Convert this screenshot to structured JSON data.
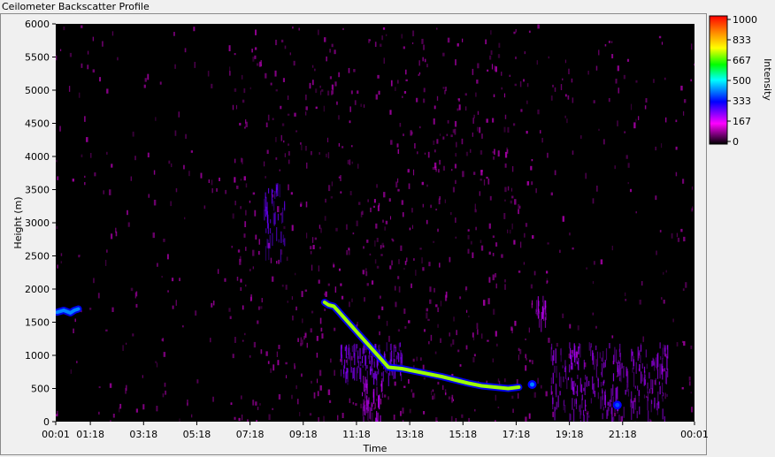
{
  "window": {
    "title": "Ceilometer Backscatter Profile"
  },
  "chart_data": {
    "type": "heatmap",
    "title": "Ceilometer Backscatter Profile",
    "xlabel": "Time",
    "ylabel": "Height (m)",
    "x_ticks": [
      "00:01",
      "01:18",
      "03:18",
      "05:18",
      "07:18",
      "09:18",
      "11:18",
      "13:18",
      "15:18",
      "17:18",
      "19:18",
      "21:18",
      "00:01"
    ],
    "y_ticks": [
      0,
      500,
      1000,
      1500,
      2000,
      2500,
      3000,
      3500,
      4000,
      4500,
      5000,
      5500,
      6000
    ],
    "ylim": [
      0,
      6000
    ],
    "xlim_hours": [
      0,
      24
    ],
    "colorbar": {
      "label": "Intensity",
      "ticks": [
        "1000",
        "833",
        "667",
        "500",
        "333",
        "167",
        "0"
      ],
      "range": [
        0,
        1000
      ],
      "colors": [
        "#000000",
        "#ff00ff",
        "#0000ff",
        "#00ffff",
        "#00ff00",
        "#ffff00",
        "#ff8000",
        "#ff0000"
      ]
    },
    "background_scatter": {
      "description_level": "magenta speckle",
      "intensity": 120
    },
    "cloud_base_layers": [
      {
        "name": "early-low",
        "points": [
          [
            0.05,
            1650
          ],
          [
            0.3,
            1680
          ],
          [
            0.55,
            1640
          ],
          [
            0.7,
            1680
          ],
          [
            0.85,
            1700
          ]
        ],
        "intensity": 420
      },
      {
        "name": "midday-descending",
        "points": [
          [
            10.1,
            1800
          ],
          [
            10.25,
            1760
          ],
          [
            10.45,
            1740
          ],
          [
            12.5,
            820
          ],
          [
            13.0,
            800
          ],
          [
            13.5,
            760
          ],
          [
            14.0,
            720
          ],
          [
            14.5,
            680
          ],
          [
            15.0,
            630
          ],
          [
            15.5,
            580
          ],
          [
            16.0,
            540
          ],
          [
            16.5,
            520
          ],
          [
            17.0,
            500
          ],
          [
            17.4,
            520
          ]
        ],
        "intensity": 700
      },
      {
        "name": "evening-spot",
        "points": [
          [
            17.9,
            560
          ]
        ],
        "intensity": 420
      },
      {
        "name": "night-spot",
        "points": [
          [
            21.1,
            250
          ]
        ],
        "intensity": 380
      }
    ],
    "aerosol_plumes": [
      {
        "t_start": 7.8,
        "t_end": 8.6,
        "h_low": 2600,
        "h_high": 3600,
        "intensity": 260
      },
      {
        "t_start": 10.7,
        "t_end": 13.0,
        "h_low": 700,
        "h_high": 1200,
        "intensity": 240
      },
      {
        "t_start": 11.5,
        "t_end": 12.3,
        "h_low": 0,
        "h_high": 700,
        "intensity": 200
      },
      {
        "t_start": 18.6,
        "t_end": 23.0,
        "h_low": 0,
        "h_high": 1200,
        "intensity": 220
      },
      {
        "t_start": 18.0,
        "t_end": 18.4,
        "h_low": 1500,
        "h_high": 1900,
        "intensity": 200
      }
    ]
  }
}
